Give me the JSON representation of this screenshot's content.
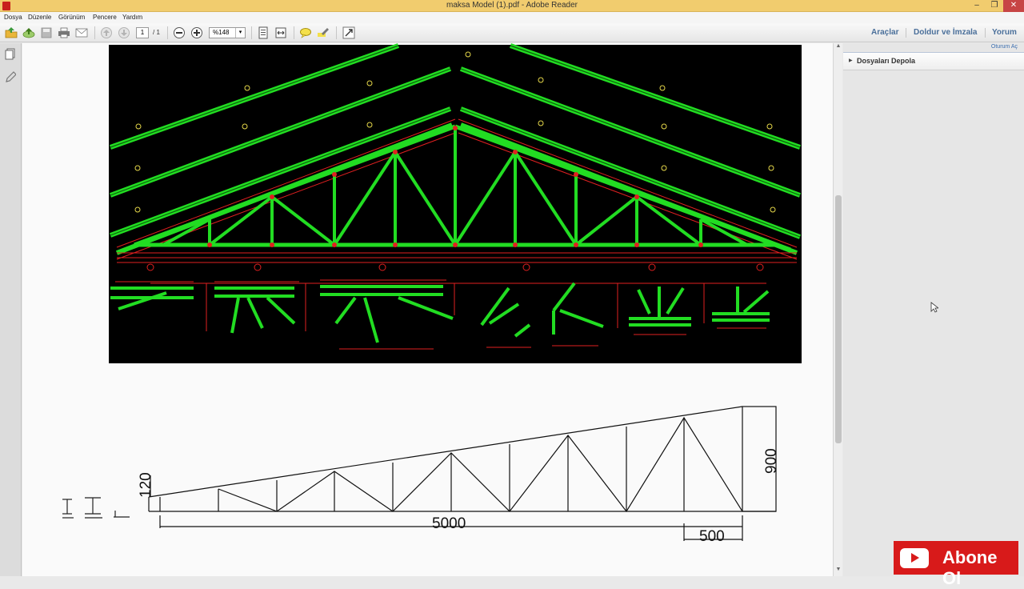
{
  "window": {
    "title": "maksa Model (1).pdf - Adobe Reader",
    "controls": {
      "minimize": "–",
      "restore": "❐",
      "close": "✕"
    }
  },
  "menu": [
    "Dosya",
    "Düzenle",
    "Görünüm",
    "Pencere",
    "Yardım"
  ],
  "toolbar": {
    "page_current": "1",
    "page_total": "/ 1",
    "zoom": "%148",
    "right_buttons": [
      "Araçlar",
      "Doldur ve İmzala",
      "Yorum"
    ]
  },
  "icons": {
    "toolbar_left": [
      "open-icon",
      "upload-icon",
      "save-icon",
      "print-icon",
      "email-icon",
      "page-up-icon",
      "page-down-icon"
    ],
    "toolbar_zoom": [
      "zoom-out-icon",
      "zoom-in-icon"
    ],
    "toolbar_view": [
      "fit-page-icon",
      "fit-width-icon",
      "comment-icon",
      "highlight-icon",
      "expand-icon"
    ],
    "left_nav": [
      "pages-icon",
      "signature-pen-icon"
    ]
  },
  "right_pane": {
    "sign_in": "Oturum Aç",
    "section": "Dosyaları Depola"
  },
  "drawing": {
    "dimensions": {
      "height_left": "120",
      "height_right": "900",
      "span": "5000",
      "end_segment": "500"
    }
  },
  "subscribe": {
    "label": "Abone Ol"
  },
  "colors": {
    "titlebar": "#f1cc6e",
    "truss_green": "#22dd22",
    "truss_red": "#e02020",
    "cad_background": "#000000",
    "link_blue": "#4a6f9a",
    "youtube_red": "#d81a1a"
  }
}
